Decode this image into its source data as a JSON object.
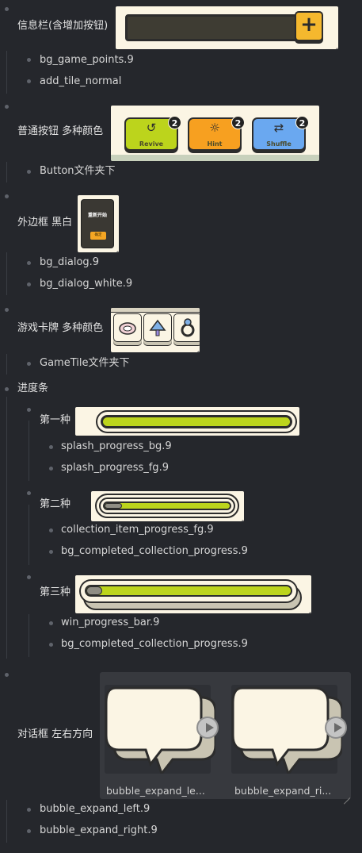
{
  "sections": {
    "info_bar": {
      "label": "信息栏(含增加按钮)",
      "plus": "+",
      "items": [
        "bg_game_points.9",
        "add_tile_normal"
      ]
    },
    "buttons": {
      "label": "普通按钮 多种颜色",
      "revive": "Revive",
      "hint": "Hint",
      "shuffle": "Shuffle",
      "badge": "2",
      "items": [
        "Button文件夹下"
      ]
    },
    "frame": {
      "label": "外边框 黑白",
      "dialog_title": "重新开始",
      "dialog_button": "确定",
      "items": [
        "bg_dialog.9",
        "bg_dialog_white.9"
      ]
    },
    "tiles": {
      "label": "游戏卡牌 多种颜色",
      "items": [
        "GameTile文件夹下"
      ]
    },
    "progress": {
      "label": "进度条",
      "first": {
        "label": "第一种",
        "items": [
          "splash_progress_bg.9",
          "splash_progress_fg.9"
        ]
      },
      "second": {
        "label": "第二种",
        "items": [
          "collection_item_progress_fg.9",
          "bg_completed_collection_progress.9"
        ]
      },
      "third": {
        "label": "第三种",
        "items": [
          "win_progress_bar.9",
          "bg_completed_collection_progress.9"
        ]
      }
    },
    "bubble": {
      "label": "对话框 左右方向",
      "caption_left": "bubble_expand_le...",
      "caption_right": "bubble_expand_ri...",
      "items": [
        "bubble_expand_left.9",
        "bubble_expand_right.9"
      ]
    }
  },
  "colors": {
    "background": "#25272c",
    "cream": "#fbf5e4",
    "yellow": "#f5b82e",
    "green": "#bcd41c",
    "orange": "#f7a020",
    "blue": "#6aa8f0",
    "dark_bar": "#3e3c33"
  }
}
